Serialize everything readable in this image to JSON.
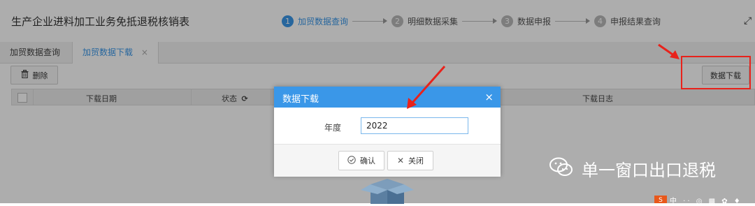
{
  "header": {
    "app_title": "生产企业进料加工业务免抵退税核销表",
    "steps": [
      {
        "num": "1",
        "label": "加贸数据查询"
      },
      {
        "num": "2",
        "label": "明细数据采集"
      },
      {
        "num": "3",
        "label": "数据申报"
      },
      {
        "num": "4",
        "label": "申报结果查询"
      }
    ],
    "corner_icon": "expand-icon"
  },
  "tabs": [
    {
      "label": "加贸数据查询"
    },
    {
      "label": "加贸数据下载",
      "close": "×"
    }
  ],
  "toolbar": {
    "delete_label": "删除",
    "delete_icon": "trash-icon",
    "download_label": "数据下载"
  },
  "grid": {
    "columns": [
      "下载日期",
      "状态",
      "下载日志"
    ],
    "refresh_icon": "refresh-icon"
  },
  "dialog": {
    "title": "数据下载",
    "close": "×",
    "year_label": "年度",
    "year_value": "2022",
    "ok_label": "确认",
    "ok_icon": "check-circle-icon",
    "close_label": "关闭",
    "close_icon": "x-icon"
  },
  "watermark": {
    "text": "单一窗口出口退税",
    "icon": "wechat-icon",
    "bottom_logo": "S",
    "bottom_chars": "中 ·· ◎ ▩ ✿ ♦"
  },
  "colors": {
    "accent": "#3a97e8",
    "annotation": "#e8221b"
  }
}
